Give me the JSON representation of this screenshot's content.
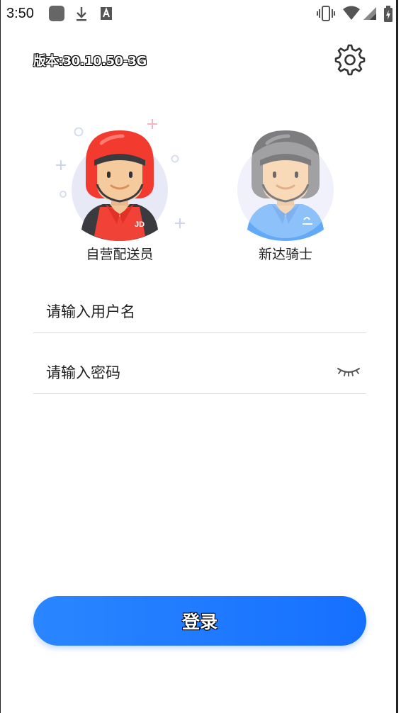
{
  "status_bar": {
    "time": "3:50",
    "icons": [
      "app-icon",
      "download-icon",
      "a-icon",
      "vibrate-icon",
      "wifi-icon",
      "cellular-icon",
      "battery-charging-icon"
    ]
  },
  "header": {
    "version": "版本:30.10.50-3G",
    "settings_icon": "gear-icon"
  },
  "roles": [
    {
      "label": "自营配送员",
      "badge": "JD",
      "icon": "courier-avatar-icon",
      "accent": "#f23a2e"
    },
    {
      "label": "新达骑士",
      "icon": "rider-avatar-icon",
      "accent": "#4d9ff5"
    }
  ],
  "form": {
    "username_placeholder": "请输入用户名",
    "password_placeholder": "请输入密码",
    "eye_icon": "eye-closed-icon"
  },
  "login": {
    "label": "登录",
    "color": "#1f7bff"
  }
}
